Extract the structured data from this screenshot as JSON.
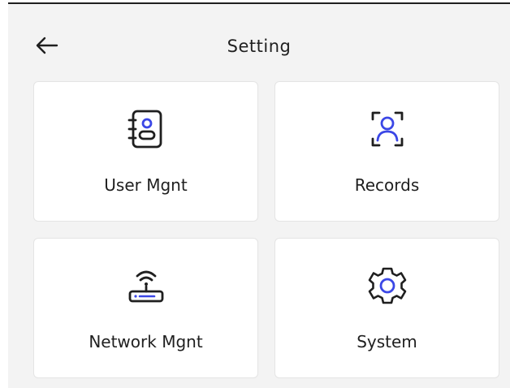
{
  "header": {
    "title": "Setting",
    "back_icon": "arrow-left-icon"
  },
  "tiles": [
    {
      "label": "User Mgnt",
      "icon": "user-card-icon"
    },
    {
      "label": "Records",
      "icon": "face-scan-icon"
    },
    {
      "label": "Network Mgnt",
      "icon": "wifi-router-icon"
    },
    {
      "label": "System",
      "icon": "gear-icon"
    }
  ],
  "colors": {
    "accent": "#3b47e6",
    "icon_dark": "#1f1f1f",
    "background": "#f3f3f3",
    "tile": "#ffffff"
  }
}
